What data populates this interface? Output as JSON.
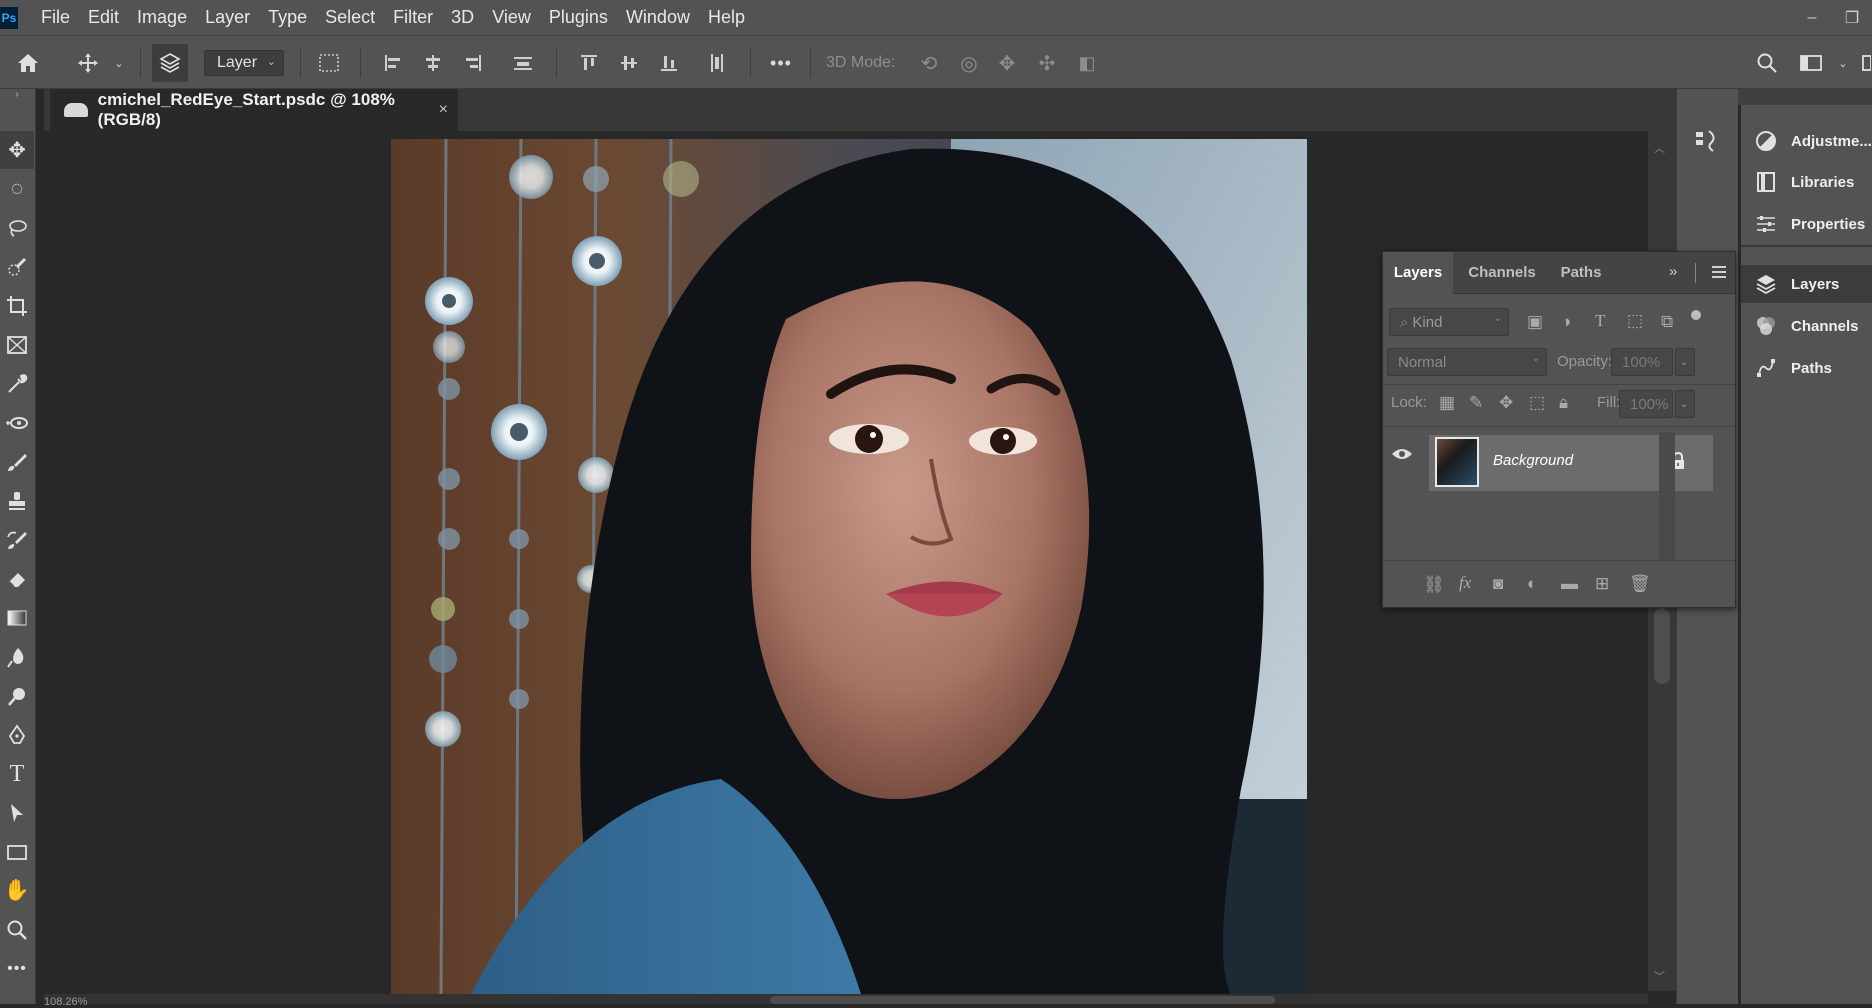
{
  "app": {
    "logo": "Ps"
  },
  "menu": [
    "File",
    "Edit",
    "Image",
    "Layer",
    "Type",
    "Select",
    "Filter",
    "3D",
    "View",
    "Plugins",
    "Window",
    "Help"
  ],
  "window_controls": {
    "minimize": "–",
    "restore": "❐"
  },
  "options_bar": {
    "layer_dropdown": "Layer",
    "mode_3d_label": "3D Mode:",
    "more_label": "•••"
  },
  "document": {
    "tab_title": "cmichel_RedEye_Start.psdc @ 108% (RGB/8)",
    "close_glyph": "×"
  },
  "status": {
    "zoom": "108.26%"
  },
  "right_panel_column": {
    "group1": [
      "Adjustme...",
      "Libraries",
      "Properties"
    ],
    "group2": [
      "Layers",
      "Channels",
      "Paths"
    ]
  },
  "layers_panel": {
    "tabs": [
      "Layers",
      "Channels",
      "Paths"
    ],
    "active_tab": "Layers",
    "kind_placeholder": "Kind",
    "blend_mode": "Normal",
    "opacity_label": "Opacity:",
    "opacity_value": "100%",
    "lock_label": "Lock:",
    "fill_label": "Fill:",
    "fill_value": "100%",
    "layers": [
      {
        "name": "Background",
        "visible": true,
        "locked": true
      }
    ]
  },
  "colors": {
    "chrome": "#535353",
    "canvas_bg": "#282828",
    "accent": "#31a8ff"
  }
}
